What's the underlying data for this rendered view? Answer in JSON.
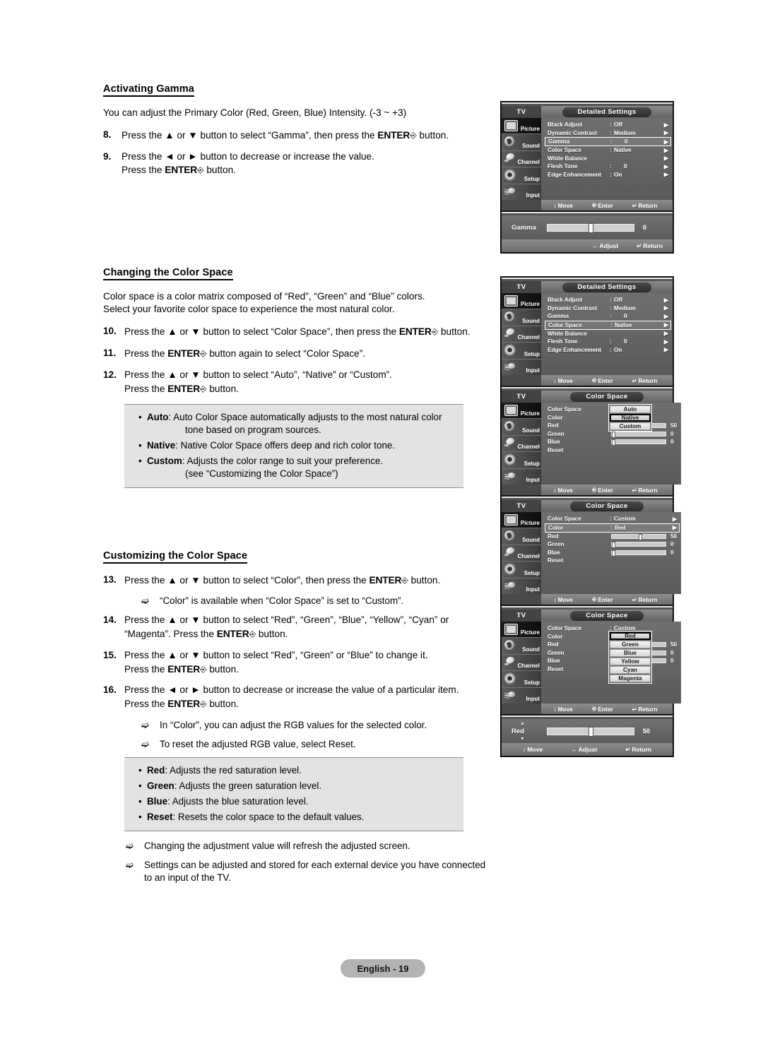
{
  "document": {
    "footer_label": "English - 19"
  },
  "sections": [
    {
      "heading": "Activating Gamma",
      "intro": "You can adjust the Primary Color (Red, Green, Blue) Intensity. (-3 ~ +3)",
      "steps": [
        {
          "num": "8.",
          "line1_a": "Press the ▲ or ▼ button to select “Gamma”, then press the ",
          "enter": "ENTER",
          "line1_b": " button.",
          "line2": ""
        },
        {
          "num": "9.",
          "line1_a": "Press the ◄ or ► button to decrease or increase the value.",
          "line2_a": "Press the ",
          "enter": "ENTER",
          "line2_b": " button."
        }
      ]
    },
    {
      "heading": "Changing the Color Space",
      "intro_line1": "Color space is a color matrix composed of “Red”, “Green” and “Blue” colors.",
      "intro_line2": "Select your favorite color space to experience the most natural color.",
      "steps": [
        {
          "num": "10.",
          "a": "Press the ▲ or ▼ button to select “Color Space”, then press the ",
          "enter": "ENTER",
          "b": " button."
        },
        {
          "num": "11.",
          "a": "Press the ",
          "enter": "ENTER",
          "b": " button again to select “Color Space”."
        },
        {
          "num": "12.",
          "a": "Press the ▲ or ▼ button to select “Auto”, “Native” or “Custom”.",
          "b2a": "Press the ",
          "enter2": "ENTER",
          "b2b": " button."
        }
      ],
      "infobox": {
        "items": [
          {
            "term": "Auto",
            "desc": ": Auto Color Space automatically adjusts to the most natural color",
            "sub": "tone based on program sources."
          },
          {
            "term": "Native",
            "desc": ": Native Color Space offers deep and rich color tone.",
            "sub": ""
          },
          {
            "term": "Custom",
            "desc": ": Adjusts the color range to suit your preference.",
            "sub": "(see “Customizing the Color Space”)"
          }
        ]
      }
    },
    {
      "heading": "Customizing the Color Space",
      "steps": [
        {
          "num": "13.",
          "a": "Press the ▲ or ▼ button to select “Color”, then press the ",
          "enter": "ENTER",
          "b": " button."
        },
        {
          "num": "14.",
          "a": "Press the ▲ or ▼ button to select “Red”, “Green”, “Blue”, “Yellow”, “Cyan” or",
          "b2a": "“Magenta”. Press the ",
          "enter2": "ENTER",
          "b2b": " button."
        },
        {
          "num": "15.",
          "a": "Press the ▲ or ▼ button to select “Red”, “Green” or “Blue” to change it.",
          "b2a": "Press the ",
          "enter2": "ENTER",
          "b2b": " button."
        },
        {
          "num": "16.",
          "a": "Press the ◄ or ► button to decrease or increase the value of a particular item.",
          "b2a": "Press the ",
          "enter2": "ENTER",
          "b2b": " button."
        }
      ],
      "notes": [
        "“Color” is available when “Color Space” is set to “Custom”.",
        "In “Color”, you can adjust the RGB values for the selected color.",
        "To reset the adjusted RGB value, select Reset."
      ],
      "infobox": {
        "items": [
          {
            "term": "Red",
            "desc": ": Adjusts the red saturation level."
          },
          {
            "term": "Green",
            "desc": ": Adjusts the green saturation level."
          },
          {
            "term": "Blue",
            "desc": ": Adjusts the blue saturation level."
          },
          {
            "term": "Reset",
            "desc": ": Resets the color space to the default values."
          }
        ]
      },
      "trailing_notes": [
        "Changing the adjustment value will refresh the adjusted screen.",
        "Settings can be adjusted and stored for each external device you have connected to an input of the TV."
      ]
    }
  ],
  "osd": {
    "tv_tag": "TV",
    "sidebar": [
      {
        "label": "Picture",
        "icon": "picture-icon"
      },
      {
        "label": "Sound",
        "icon": "sound-icon"
      },
      {
        "label": "Channel",
        "icon": "channel-icon"
      },
      {
        "label": "Setup",
        "icon": "setup-icon"
      },
      {
        "label": "Input",
        "icon": "input-icon"
      }
    ],
    "hints": {
      "move": "Move",
      "enter": "Enter",
      "return": "Return",
      "adjust": "Adjust"
    },
    "panel1": {
      "title": "Detailed Settings",
      "rows": [
        {
          "label": "Black Adjust",
          "value": "Off",
          "selected": false
        },
        {
          "label": "Dynamic Contrast",
          "value": "Medium",
          "selected": false
        },
        {
          "label": "Gamma",
          "value": "0",
          "selected": true
        },
        {
          "label": "Color Space",
          "value": "Native",
          "selected": false
        },
        {
          "label": "White Balance",
          "value": "",
          "selected": false
        },
        {
          "label": "Flesh Tone",
          "value": "0",
          "selected": false
        },
        {
          "label": "Edge Enhancement",
          "value": "On",
          "selected": false
        }
      ]
    },
    "bar1": {
      "label": "Gamma",
      "value": "0",
      "position_pct": 50
    },
    "panel2": {
      "title": "Detailed Settings",
      "rows": [
        {
          "label": "Black Adjust",
          "value": "Off",
          "selected": false
        },
        {
          "label": "Dynamic Contrast",
          "value": "Medium",
          "selected": false
        },
        {
          "label": "Gamma",
          "value": "0",
          "selected": false
        },
        {
          "label": "Color Space",
          "value": "Native",
          "selected": true
        },
        {
          "label": "White Balance",
          "value": "",
          "selected": false
        },
        {
          "label": "Flesh Tone",
          "value": "0",
          "selected": false
        },
        {
          "label": "Edge Enhancement",
          "value": "On",
          "selected": false
        }
      ]
    },
    "panel3": {
      "title": "Color Space",
      "rows": [
        {
          "label": "Color Space",
          "type": "value",
          "value": ""
        },
        {
          "label": "Color",
          "type": "value",
          "value": ""
        },
        {
          "label": "Red",
          "type": "slider",
          "value": "50",
          "position_pct": 50
        },
        {
          "label": "Green",
          "type": "slider",
          "value": "0",
          "position_pct": 0
        },
        {
          "label": "Blue",
          "type": "slider",
          "value": "0",
          "position_pct": 0
        },
        {
          "label": "Reset",
          "type": "plain",
          "value": ""
        }
      ],
      "popup": {
        "options": [
          "Auto",
          "Native",
          "Custom"
        ],
        "selected": "Native"
      }
    },
    "panel4": {
      "title": "Color Space",
      "rows": [
        {
          "label": "Color Space",
          "type": "value",
          "value": "Custom",
          "selected": false
        },
        {
          "label": "Color",
          "type": "value",
          "value": "Red",
          "selected": true
        },
        {
          "label": "Red",
          "type": "slider",
          "value": "50",
          "position_pct": 50
        },
        {
          "label": "Green",
          "type": "slider",
          "value": "0",
          "position_pct": 0
        },
        {
          "label": "Blue",
          "type": "slider",
          "value": "0",
          "position_pct": 0
        },
        {
          "label": "Reset",
          "type": "plain",
          "value": ""
        }
      ]
    },
    "panel5": {
      "title": "Color Space",
      "rows": [
        {
          "label": "Color Space",
          "type": "value",
          "value": "Custom"
        },
        {
          "label": "Color",
          "type": "value",
          "value": ""
        },
        {
          "label": "Red",
          "type": "slider",
          "value": "50",
          "position_pct": 50
        },
        {
          "label": "Green",
          "type": "slider",
          "value": "0",
          "position_pct": 0
        },
        {
          "label": "Blue",
          "type": "slider",
          "value": "0",
          "position_pct": 0
        },
        {
          "label": "Reset",
          "type": "plain",
          "value": ""
        }
      ],
      "popup": {
        "options": [
          "Red",
          "Green",
          "Blue",
          "Yellow",
          "Cyan",
          "Magenta"
        ],
        "selected": "Red"
      }
    },
    "bar2": {
      "label": "Red",
      "value": "50",
      "position_pct": 50
    }
  }
}
